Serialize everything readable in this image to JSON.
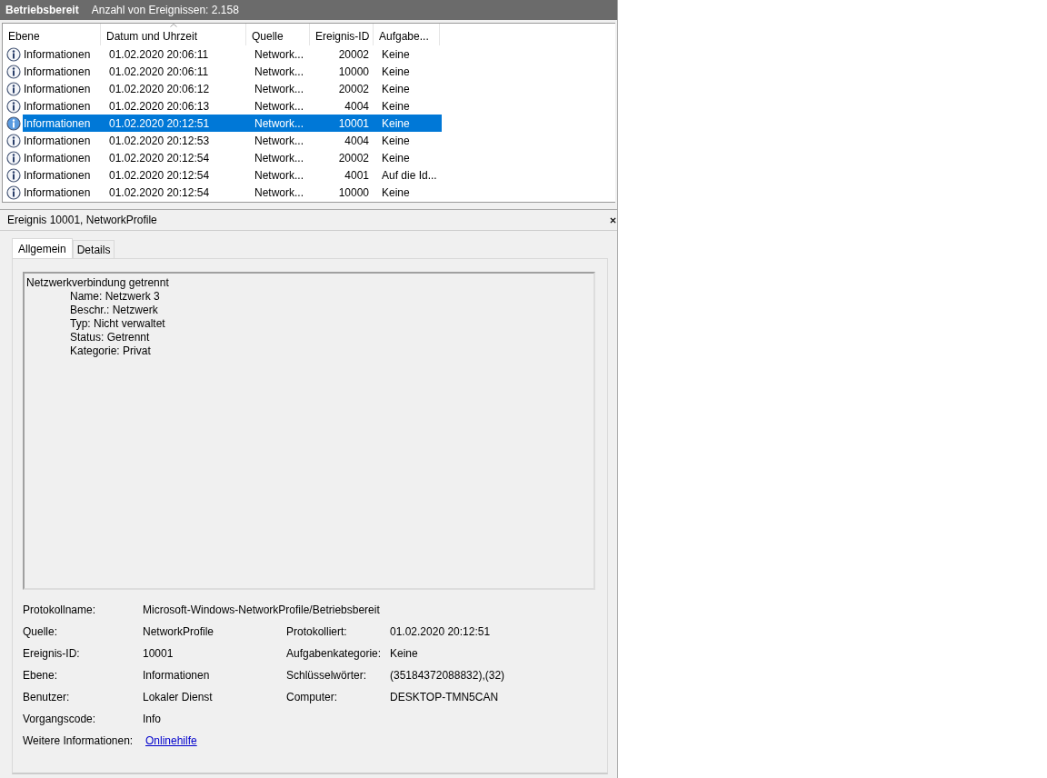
{
  "header": {
    "title": "Betriebsbereit",
    "count": "Anzahl von Ereignissen: 2.158"
  },
  "table": {
    "columns": [
      {
        "label": "Ebene",
        "sorted": false
      },
      {
        "label": "Datum und Uhrzeit",
        "sorted": true
      },
      {
        "label": "Quelle",
        "sorted": false
      },
      {
        "label": "Ereignis-ID",
        "sorted": false
      },
      {
        "label": "Aufgabe...",
        "sorted": false
      }
    ],
    "rows": [
      {
        "level": "Informationen",
        "date": "01.02.2020 20:06:11",
        "source": "Network...",
        "id": "20002",
        "task": "Keine",
        "selected": false
      },
      {
        "level": "Informationen",
        "date": "01.02.2020 20:06:11",
        "source": "Network...",
        "id": "10000",
        "task": "Keine",
        "selected": false
      },
      {
        "level": "Informationen",
        "date": "01.02.2020 20:06:12",
        "source": "Network...",
        "id": "20002",
        "task": "Keine",
        "selected": false
      },
      {
        "level": "Informationen",
        "date": "01.02.2020 20:06:13",
        "source": "Network...",
        "id": "4004",
        "task": "Keine",
        "selected": false
      },
      {
        "level": "Informationen",
        "date": "01.02.2020 20:12:51",
        "source": "Network...",
        "id": "10001",
        "task": "Keine",
        "selected": true
      },
      {
        "level": "Informationen",
        "date": "01.02.2020 20:12:53",
        "source": "Network...",
        "id": "4004",
        "task": "Keine",
        "selected": false
      },
      {
        "level": "Informationen",
        "date": "01.02.2020 20:12:54",
        "source": "Network...",
        "id": "20002",
        "task": "Keine",
        "selected": false
      },
      {
        "level": "Informationen",
        "date": "01.02.2020 20:12:54",
        "source": "Network...",
        "id": "4001",
        "task": "Auf die Id...",
        "selected": false
      },
      {
        "level": "Informationen",
        "date": "01.02.2020 20:12:54",
        "source": "Network...",
        "id": "10000",
        "task": "Keine",
        "selected": false
      }
    ]
  },
  "detail": {
    "title": "Ereignis 10001, NetworkProfile",
    "tabs": [
      {
        "label": "Allgemein",
        "selected": true
      },
      {
        "label": "Details",
        "selected": false
      }
    ],
    "message": {
      "heading": "Netzwerkverbindung getrennt",
      "lines": [
        "Name: Netzwerk 3",
        "Beschr.: Netzwerk",
        "Typ: Nicht verwaltet",
        "Status: Getrennt",
        "Kategorie: Privat"
      ]
    },
    "rows": [
      {
        "cells": [
          {
            "label": "Protokollname:",
            "value": "Microsoft-Windows-NetworkProfile/Betriebsbereit",
            "kind": "wide"
          }
        ]
      },
      {
        "cells": [
          {
            "label": "Quelle:",
            "value": "NetworkProfile",
            "kind": "text"
          },
          {
            "label": "Protokolliert:",
            "value": "01.02.2020 20:12:51",
            "kind": "text"
          }
        ]
      },
      {
        "cells": [
          {
            "label": "Ereignis-ID:",
            "value": "10001",
            "kind": "text"
          },
          {
            "label": "Aufgabenkategorie:",
            "value": "Keine",
            "kind": "text"
          }
        ]
      },
      {
        "cells": [
          {
            "label": "Ebene:",
            "value": "Informationen",
            "kind": "text"
          },
          {
            "label": "Schlüsselwörter:",
            "value": "(35184372088832),(32)",
            "kind": "text"
          }
        ]
      },
      {
        "cells": [
          {
            "label": "Benutzer:",
            "value": "Lokaler Dienst",
            "kind": "text"
          },
          {
            "label": "Computer:",
            "value": "DESKTOP-TMN5CAN",
            "kind": "text"
          }
        ]
      },
      {
        "cells": [
          {
            "label": "Vorgangscode:",
            "value": "Info",
            "kind": "text"
          }
        ]
      },
      {
        "cells": [
          {
            "label": "Weitere Informationen:",
            "value": "Onlinehilfe",
            "kind": "link"
          }
        ]
      }
    ]
  }
}
